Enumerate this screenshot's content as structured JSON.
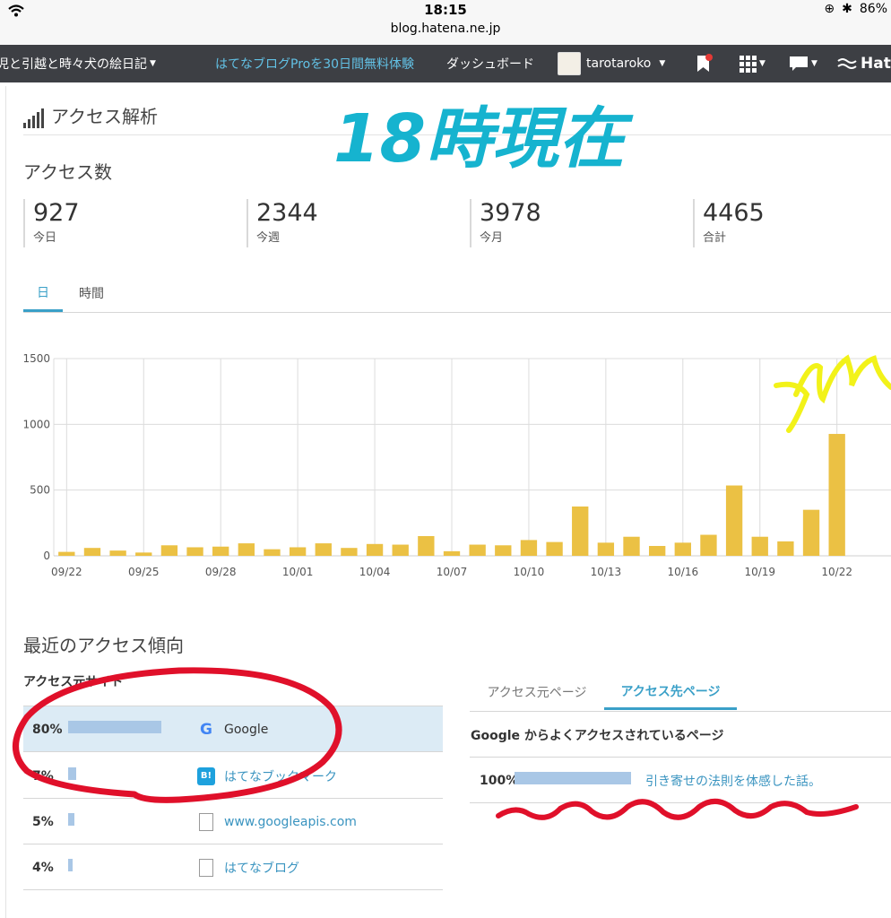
{
  "status_bar": {
    "time": "18:15",
    "url": "blog.hatena.ne.jp",
    "battery": "86%"
  },
  "navbar": {
    "blog_title": "児と引越と時々犬の絵日記",
    "pro_trial": "はてなブログProを30日間無料体験",
    "dashboard": "ダッシュボード",
    "username": "tarotaroko",
    "brand": "Hat"
  },
  "page": {
    "title": "アクセス解析",
    "handwritten_title": "18時現在",
    "access_title": "アクセス数",
    "stats": [
      {
        "value": "927",
        "label": "今日"
      },
      {
        "value": "2344",
        "label": "今週"
      },
      {
        "value": "3978",
        "label": "今月"
      },
      {
        "value": "4465",
        "label": "合計"
      }
    ],
    "tabs": {
      "day": "日",
      "hour": "時間"
    }
  },
  "chart_data": {
    "type": "bar",
    "categories": [
      "09/22",
      "09/23",
      "09/24",
      "09/25",
      "09/26",
      "09/27",
      "09/28",
      "09/29",
      "09/30",
      "10/01",
      "10/02",
      "10/03",
      "10/04",
      "10/05",
      "10/06",
      "10/07",
      "10/08",
      "10/09",
      "10/10",
      "10/11",
      "10/12",
      "10/13",
      "10/14",
      "10/15",
      "10/16",
      "10/17",
      "10/18",
      "10/19",
      "10/20",
      "10/21",
      "10/22"
    ],
    "values": [
      30,
      60,
      40,
      25,
      80,
      65,
      70,
      95,
      50,
      65,
      95,
      60,
      90,
      85,
      150,
      35,
      85,
      80,
      120,
      105,
      375,
      100,
      145,
      75,
      100,
      160,
      535,
      145,
      110,
      350,
      927
    ],
    "x_tick_labels": [
      "09/22",
      "09/25",
      "09/28",
      "10/01",
      "10/04",
      "10/07",
      "10/10",
      "10/13",
      "10/16",
      "10/19",
      "10/22"
    ],
    "y_ticks": [
      0,
      500,
      1000,
      1500
    ],
    "ylim": [
      0,
      1500
    ],
    "grid": true,
    "bar_color": "#ebc144"
  },
  "trends": {
    "title": "最近のアクセス傾向",
    "sites_label": "アクセス元サイト",
    "sites": [
      {
        "pct": "80%",
        "share": 80,
        "name": "Google",
        "icon": "google-icon",
        "selected": true
      },
      {
        "pct": "7%",
        "share": 7,
        "name": "はてなブックマーク",
        "icon": "hatena-bookmark-icon",
        "selected": false
      },
      {
        "pct": "5%",
        "share": 5,
        "name": "www.googleapis.com",
        "icon": "document-icon",
        "selected": false
      },
      {
        "pct": "4%",
        "share": 4,
        "name": "はてなブログ",
        "icon": "document-icon",
        "selected": false
      }
    ],
    "page_tabs": {
      "from": "アクセス元ページ",
      "to": "アクセス先ページ"
    },
    "pages_label": "Google からよくアクセスされているページ",
    "pages": [
      {
        "pct": "100%",
        "share": 100,
        "title": "引き寄せの法則を体感した話。"
      }
    ]
  },
  "colors": {
    "nav_bg": "#3d3f44",
    "accent": "#3aa0c8",
    "handwriting_cyan": "#16b3cf",
    "handwriting_red": "#e0102a",
    "handwriting_yellow": "#f2f219"
  }
}
